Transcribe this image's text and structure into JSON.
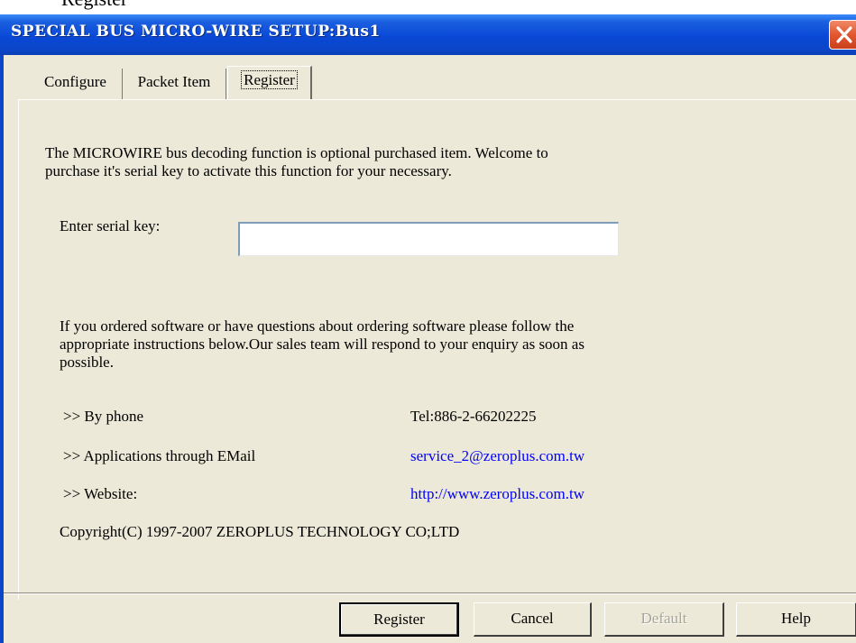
{
  "background_caption": "Register",
  "window": {
    "title": "SPECIAL BUS MICRO-WIRE SETUP:Bus1"
  },
  "tabs": [
    {
      "label": "Configure"
    },
    {
      "label": "Packet Item"
    },
    {
      "label": "Register"
    }
  ],
  "register_panel": {
    "intro_line1": "The MICROWIRE bus decoding function is optional purchased item. Welcome to",
    "intro_line2": "purchase it's serial key to activate this function for your necessary.",
    "serial_label": "Enter serial key:",
    "serial_value": "",
    "info_line1": "If you ordered software or have questions about ordering software please follow the",
    "info_line2": "appropriate instructions below.Our sales team will respond to your enquiry as soon as",
    "info_line3": "possible.",
    "contacts": [
      {
        "label": ">> By phone",
        "value": "Tel:886-2-66202225"
      },
      {
        "label": ">> Applications through EMail",
        "value": "service_2@zeroplus.com.tw"
      },
      {
        "label": ">> Website:",
        "value": "http://www.zeroplus.com.tw"
      }
    ],
    "copyright": "Copyright(C) 1997-2007 ZEROPLUS TECHNOLOGY CO;LTD"
  },
  "buttons": {
    "register": "Register",
    "cancel": "Cancel",
    "default": "Default",
    "help": "Help"
  },
  "colors": {
    "titlebar": "#0a48d6",
    "dialog_bg": "#ece9d8",
    "link": "#0000ff",
    "close_button": "#e2572f"
  }
}
